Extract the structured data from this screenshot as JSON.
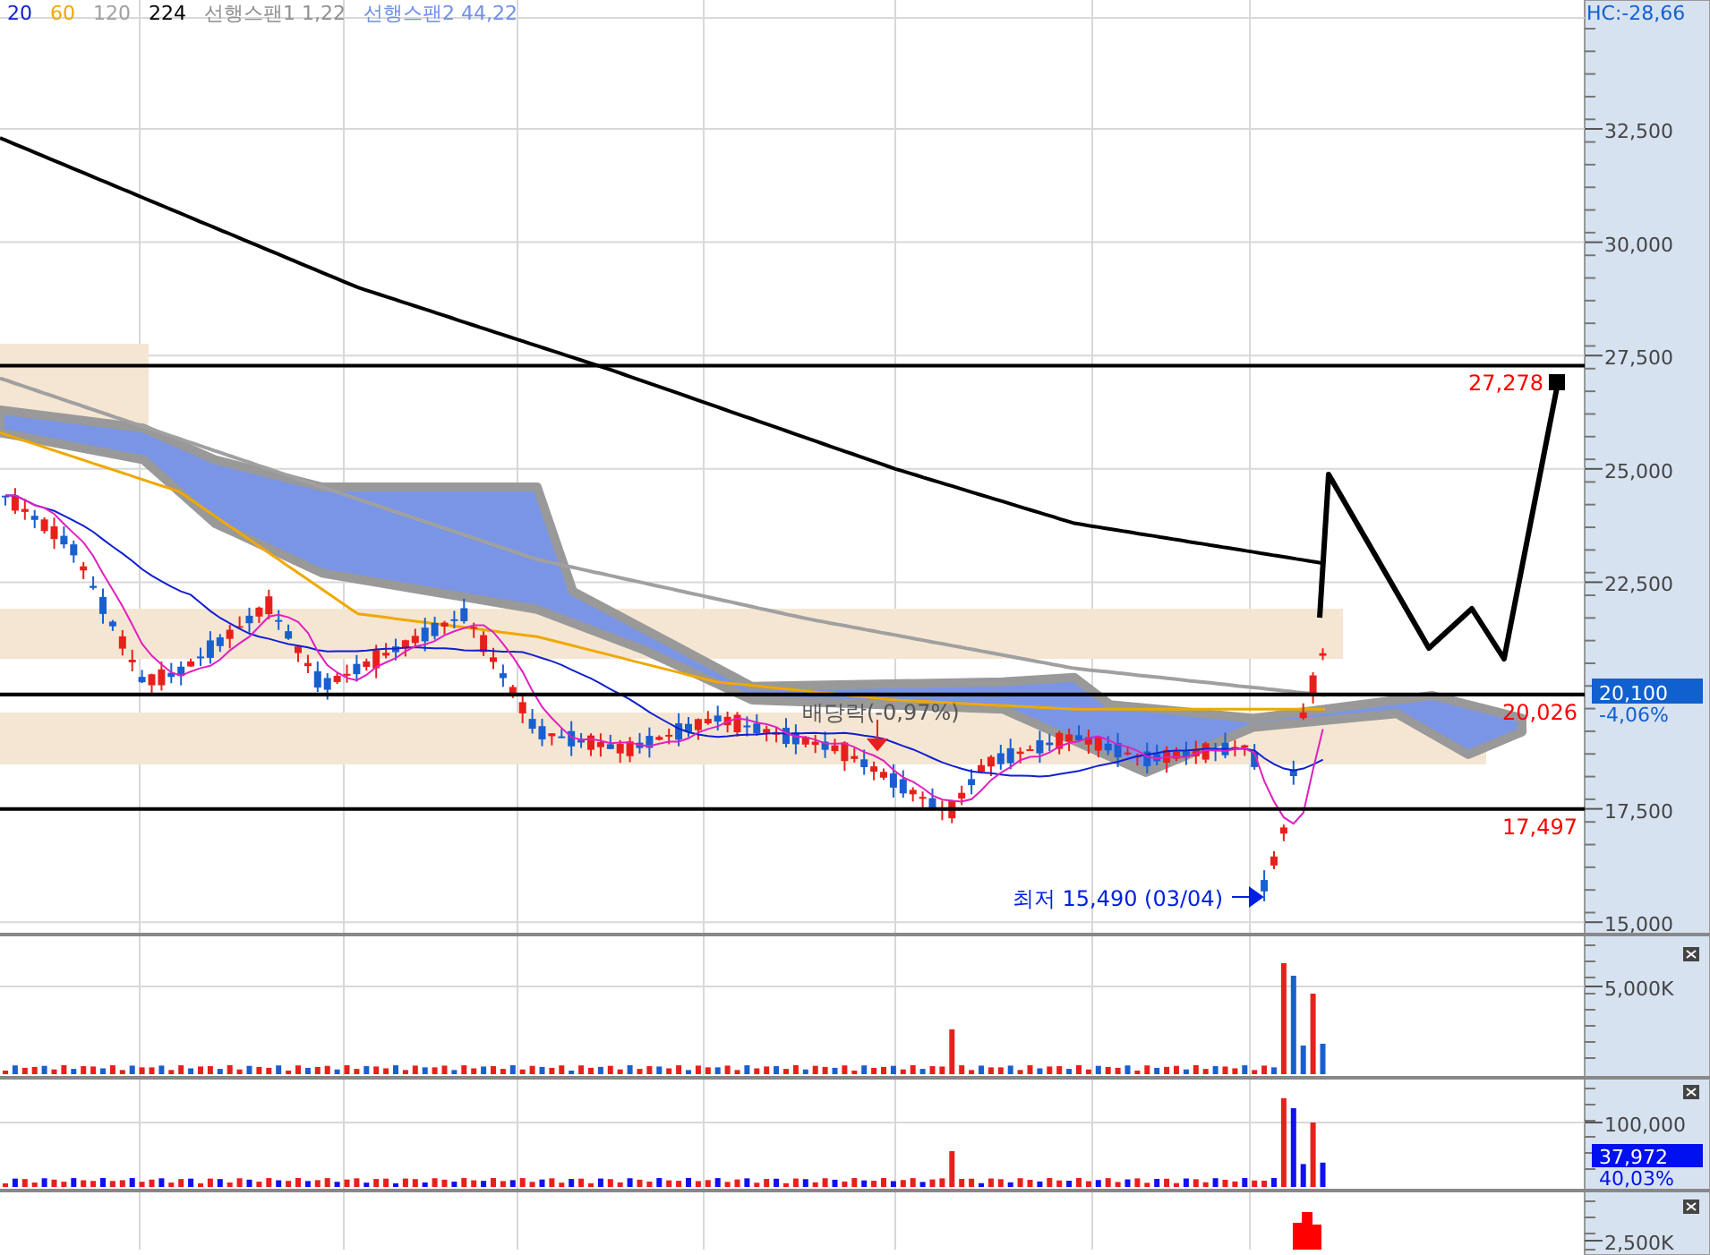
{
  "legend": [
    {
      "label": "20",
      "color": "#1020d0"
    },
    {
      "label": "60",
      "color": "#f0a800"
    },
    {
      "label": "120",
      "color": "#a0a0a0"
    },
    {
      "label": "224",
      "color": "#000000"
    },
    {
      "label": "선행스팬1 1,22",
      "color": "#909090"
    },
    {
      "label": "선행스팬2 44,22",
      "color": "#6f8fe8"
    }
  ],
  "indicator": {
    "label": "HC:-28,66"
  },
  "price_axis": {
    "ticks": [
      "32,500",
      "30,000",
      "27,500",
      "25,000",
      "22,500",
      "17,500",
      "15,000"
    ],
    "current": {
      "price": "20,100",
      "change": "-4,06%"
    }
  },
  "levels": [
    {
      "label": "27,278"
    },
    {
      "label": "20,026"
    },
    {
      "label": "17,497"
    }
  ],
  "annotations": [
    {
      "kind": "dividend",
      "text": "배당락(-0,97%)"
    },
    {
      "kind": "low",
      "text": "최저 15,490 (03/04)"
    }
  ],
  "volume_pane": {
    "ticks": [
      "5,000K"
    ]
  },
  "amount_pane": {
    "ticks": [
      "100,000"
    ],
    "current": {
      "value": "37,972",
      "change": "40,03%"
    }
  },
  "third_pane": {
    "ticks": [
      "2,500K"
    ]
  }
}
